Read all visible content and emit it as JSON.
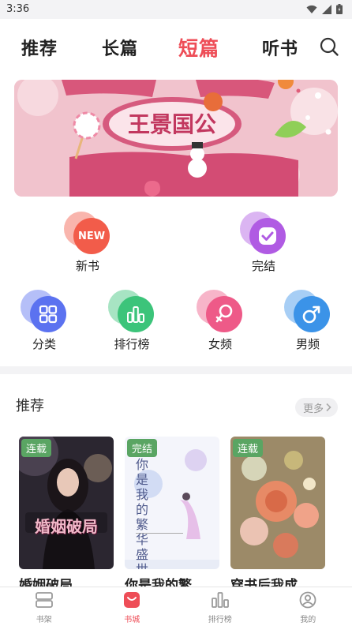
{
  "status_bar": {
    "time": "3:36"
  },
  "tabs": [
    {
      "label": "推荐",
      "active": false
    },
    {
      "label": "长篇",
      "active": false
    },
    {
      "label": "短篇",
      "active": true
    },
    {
      "label": "听书",
      "active": false
    }
  ],
  "banner": {
    "text": "王景国公"
  },
  "categories_top": [
    {
      "label": "新书",
      "icon": "new-icon",
      "badge_text": "NEW",
      "color": "#f25c4a"
    },
    {
      "label": "完结",
      "icon": "check-icon",
      "color": "#b05be3"
    }
  ],
  "categories": [
    {
      "label": "分类",
      "icon": "grid-icon",
      "color": "#5b72f0"
    },
    {
      "label": "排行榜",
      "icon": "bar-chart-icon",
      "color": "#3cc47a"
    },
    {
      "label": "女频",
      "icon": "female-icon",
      "color": "#ee5a88"
    },
    {
      "label": "男频",
      "icon": "male-icon",
      "color": "#3b93e8"
    }
  ],
  "recommend": {
    "title": "推荐",
    "more_label": "更多",
    "books": [
      {
        "title": "婚姻破局",
        "status": "连载",
        "cover_text": "婚姻破局"
      },
      {
        "title": "你是我的繁…",
        "status": "完结",
        "cover_text": "你是我的繁华盛世"
      },
      {
        "title": "穿书后我成…",
        "status": "连载"
      }
    ]
  },
  "bottom_nav": [
    {
      "label": "书架",
      "icon": "bookshelf-icon",
      "active": false
    },
    {
      "label": "书城",
      "icon": "store-icon",
      "active": true
    },
    {
      "label": "排行榜",
      "icon": "ranking-icon",
      "active": false
    },
    {
      "label": "我的",
      "icon": "profile-icon",
      "active": false
    }
  ],
  "colors": {
    "accent": "#ee4d57",
    "badge": "#5aa563"
  }
}
